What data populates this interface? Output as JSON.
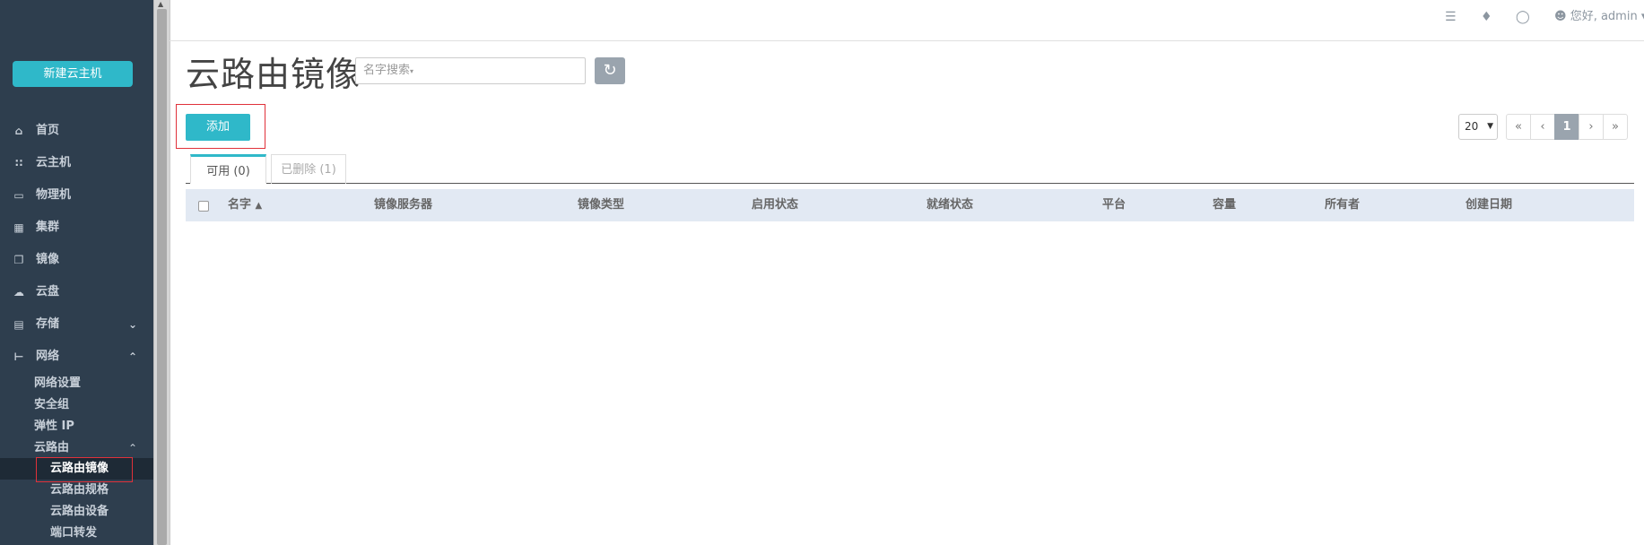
{
  "sidebar": {
    "new_vm_button": "新建云主机",
    "items": [
      {
        "label": "首页",
        "icon": "home-icon"
      },
      {
        "label": "云主机",
        "icon": "grid-small-icon"
      },
      {
        "label": "物理机",
        "icon": "monitor-icon"
      },
      {
        "label": "集群",
        "icon": "grid-icon"
      },
      {
        "label": "镜像",
        "icon": "copy-icon"
      },
      {
        "label": "云盘",
        "icon": "cloud-icon"
      },
      {
        "label": "存储",
        "icon": "hdd-icon"
      },
      {
        "label": "网络",
        "icon": "network-icon"
      }
    ],
    "network_sub": [
      "网络设置",
      "安全组",
      "弹性 IP",
      "云路由"
    ],
    "router_sub": [
      "云路由镜像",
      "云路由规格",
      "云路由设备",
      "端口转发"
    ]
  },
  "topbar": {
    "user_text": "您好, admin"
  },
  "main": {
    "title": "云路由镜像",
    "search_placeholder": "名字搜索",
    "add_button": "添加",
    "page_size": "20",
    "pager": [
      "«",
      "‹",
      "1",
      "›",
      "»"
    ],
    "tabs": [
      "可用 (0)",
      "已删除 (1)"
    ],
    "columns": [
      "名字",
      "镜像服务器",
      "镜像类型",
      "启用状态",
      "就绪状态",
      "平台",
      "容量",
      "所有者",
      "创建日期"
    ]
  },
  "colors": {
    "accent": "#2fb8c9",
    "sidebar_bg": "#2e3e4e",
    "highlight_box": "#e0313a"
  }
}
